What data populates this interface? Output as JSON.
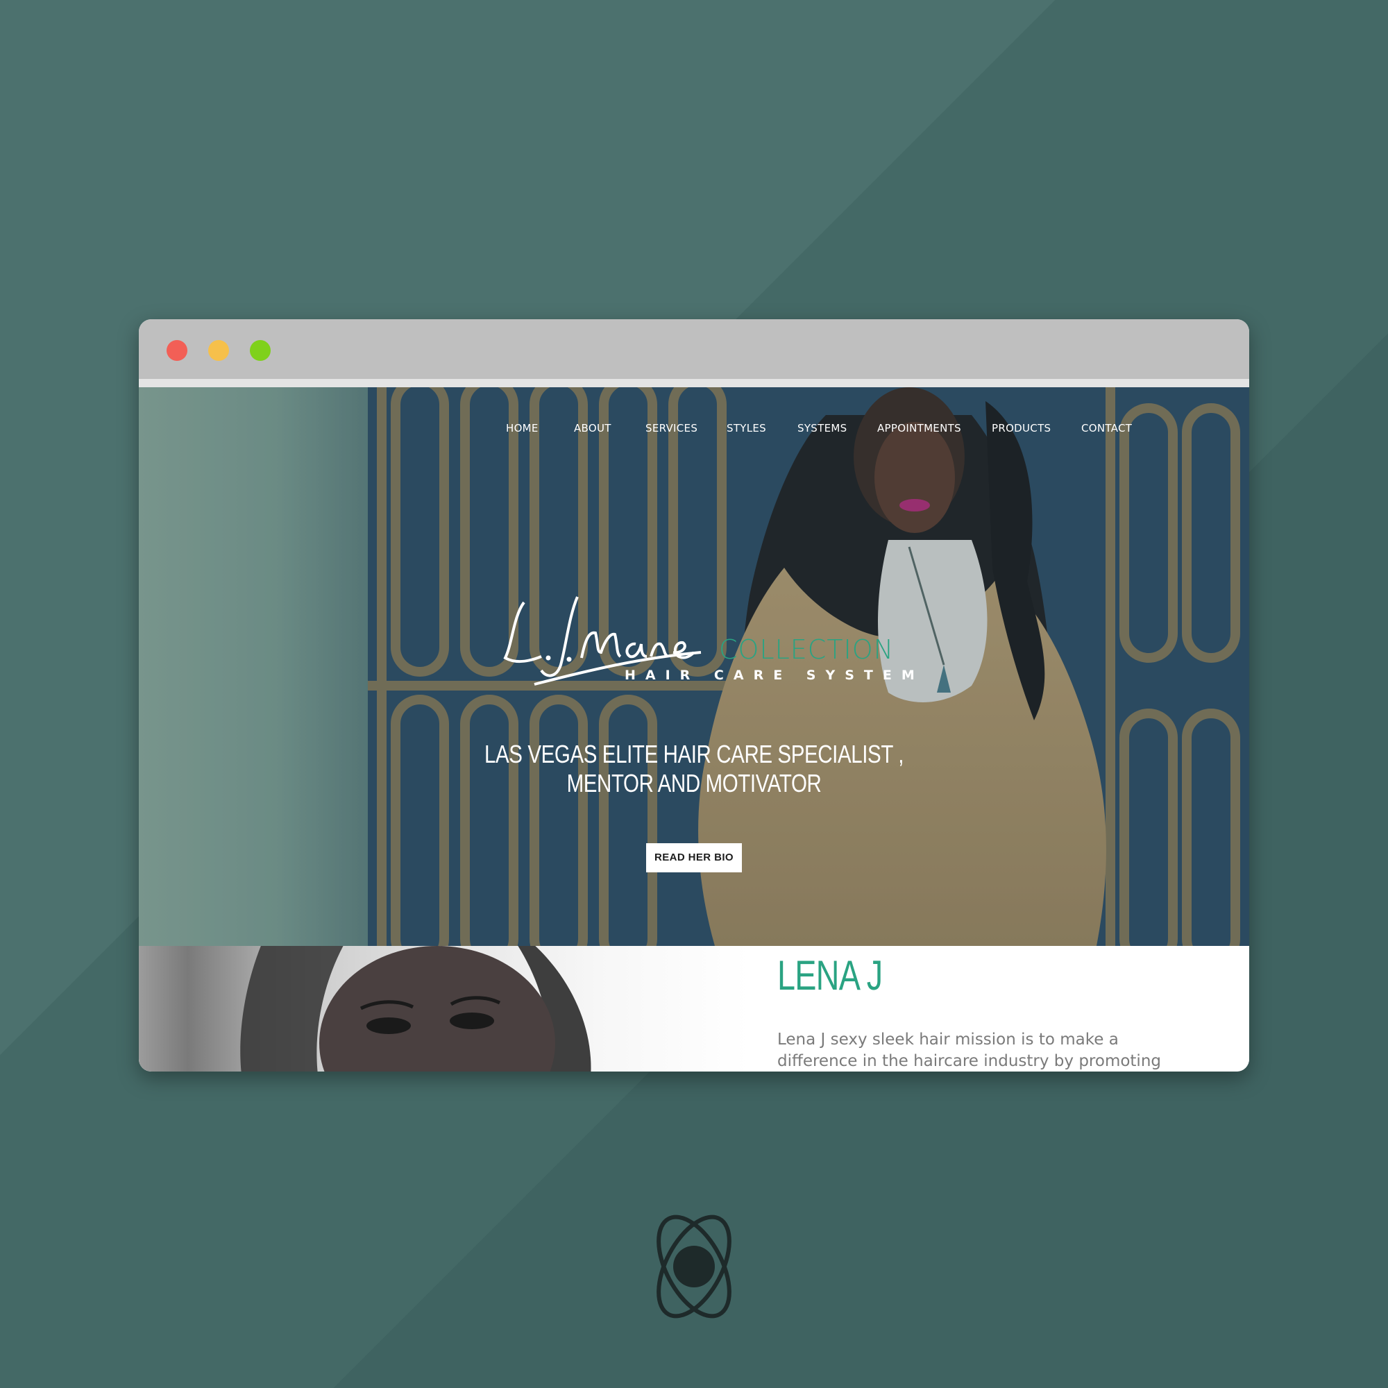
{
  "window": {
    "controls": [
      "close",
      "minimize",
      "maximize"
    ],
    "colors": {
      "close": "#f25f56",
      "minimize": "#f6c04b",
      "maximize": "#7fd11b"
    }
  },
  "nav": {
    "items": [
      "HOME",
      "ABOUT",
      "SERVICES",
      "STYLES",
      "SYSTEMS",
      "APPOINTMENTS",
      "PRODUCTS",
      "CONTACT"
    ]
  },
  "logo": {
    "script": "L.J.Mane",
    "collection": "COLLECTION",
    "tagline": "HAIR CARE SYSTEM"
  },
  "hero": {
    "headline": "LAS VEGAS ELITE HAIR CARE SPECIALIST , MENTOR AND MOTIVATOR",
    "cta": "READ HER BIO"
  },
  "about": {
    "title": "LENA J",
    "text": "Lena J sexy sleek hair mission is to make a difference in the haircare industry by promoting"
  },
  "colors": {
    "accent": "#2aa382",
    "background": "#456a68",
    "titlebar": "#bfbfbf"
  }
}
